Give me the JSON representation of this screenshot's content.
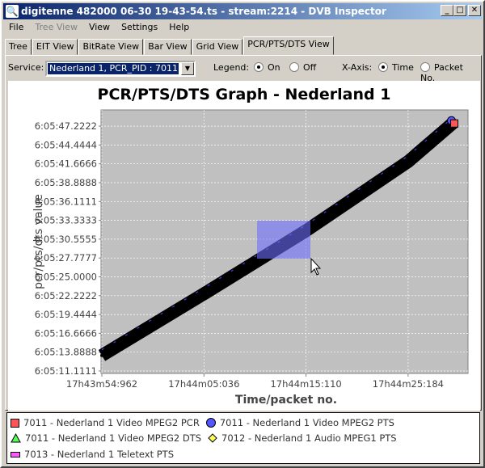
{
  "window": {
    "title": "digitenne 482000 06-30 19-43-54.ts - stream:2214 - DVB Inspector",
    "icon": "magnifier-icon"
  },
  "menu": [
    {
      "label": "File"
    },
    {
      "label": "Tree View",
      "disabled": true
    },
    {
      "label": "View"
    },
    {
      "label": "Settings"
    },
    {
      "label": "Help"
    }
  ],
  "tabs": [
    {
      "label": "Tree"
    },
    {
      "label": "EIT View"
    },
    {
      "label": "BitRate View"
    },
    {
      "label": "Bar View"
    },
    {
      "label": "Grid View"
    },
    {
      "label": "PCR/PTS/DTS View",
      "active": true
    }
  ],
  "toolbar": {
    "service_label": "Service:",
    "service_value": "Nederland 1, PCR_PID : 7011",
    "legend_label": "Legend:",
    "legend_on": "On",
    "legend_off": "Off",
    "legend_selected": "On",
    "xaxis_label": "X-Axis:",
    "xaxis_time": "Time",
    "xaxis_packet": "Packet No.",
    "xaxis_selected": "Time"
  },
  "chart_data": {
    "type": "scatter",
    "title": "PCR/PTS/DTS Graph - Nederland 1",
    "xlabel": "Time/packet no.",
    "ylabel": "pcr/pts/dts value",
    "xticks": [
      "17h43m54:962",
      "17h44m05:036",
      "17h44m15:110",
      "17h44m25:184"
    ],
    "yticks": [
      "6:05:11.1111",
      "6:05:13.8888",
      "6:05:16.6666",
      "6:05:19.4444",
      "6:05:22.2222",
      "6:05:25.0000",
      "6:05:27.7777",
      "6:05:30.5555",
      "6:05:33.3333",
      "6:05:36.1111",
      "6:05:38.8888",
      "6:05:41.6666",
      "6:05:44.4444",
      "6:05:47.2222"
    ],
    "grid": true,
    "background": "#c0c0c0",
    "legend_position": "bottom",
    "series_points": [
      {
        "x": "17h43m54:962",
        "y": "6:05:13.4"
      },
      {
        "x": "17h44m05:036",
        "y": "6:05:22.5"
      },
      {
        "x": "17h44m15:110",
        "y": "6:05:31.8"
      },
      {
        "x": "17h44m25:184",
        "y": "6:05:42.0"
      },
      {
        "x": "17h44m29:700",
        "y": "6:05:47.8"
      }
    ]
  },
  "legend": [
    {
      "label": "7011 - Nederland 1 Video MPEG2 PCR",
      "shape": "square",
      "color": "#ff5555"
    },
    {
      "label": "7011 - Nederland 1 Video MPEG2 PTS",
      "shape": "circle",
      "color": "#5555ff"
    },
    {
      "label": "7011 - Nederland 1 Video MPEG2 DTS",
      "shape": "triangle",
      "color": "#55ff55"
    },
    {
      "label": "7012 - Nederland 1 Audio MPEG1 PTS",
      "shape": "diamond",
      "color": "#ffff55"
    },
    {
      "label": "7013 - Nederland 1 Teletext PTS",
      "shape": "rect",
      "color": "#ff55ff"
    }
  ]
}
